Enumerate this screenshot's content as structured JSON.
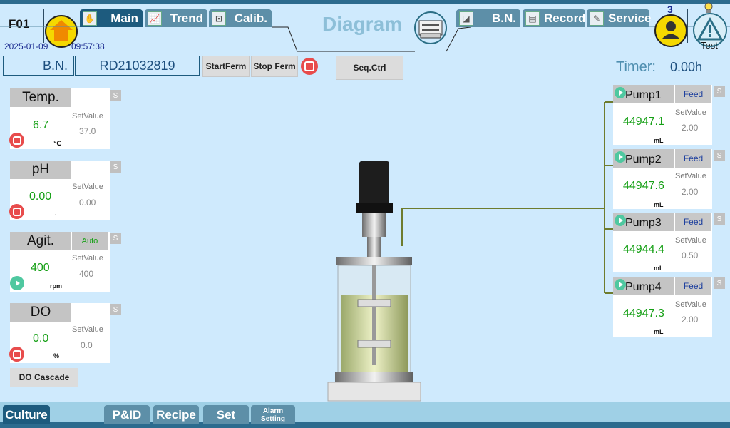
{
  "header": {
    "station": "F01",
    "date": "2025-01-09",
    "time": "09:57:38",
    "page_title": "Diagram",
    "tabs": [
      {
        "label": "Main",
        "icon": "hand-icon"
      },
      {
        "label": "Trend",
        "icon": "trend-icon"
      },
      {
        "label": "Calib.",
        "icon": "calib-icon"
      },
      {
        "label": "B.N.",
        "icon": "bn-icon"
      },
      {
        "label": "Record",
        "icon": "record-icon"
      },
      {
        "label": "Service",
        "icon": "service-icon"
      }
    ],
    "user_count": "3",
    "alarm_label": "Test"
  },
  "batch": {
    "label": "B.N.",
    "value": "RD21032819",
    "start_label": "StartFerm",
    "stop_label": "Stop Ferm",
    "seq_label": "Seq.Ctrl"
  },
  "timer": {
    "label": "Timer:",
    "value": "0.00h"
  },
  "params": [
    {
      "name": "Temp.",
      "value": "6.7",
      "setvalue_label": "SetValue",
      "setvalue": "37.0",
      "unit": "℃",
      "status": "stopped",
      "mode": "",
      "s": "S"
    },
    {
      "name": "pH",
      "value": "0.00",
      "setvalue_label": "SetValue",
      "setvalue": "0.00",
      "unit": ".",
      "status": "stopped",
      "mode": "",
      "s": "S"
    },
    {
      "name": "Agit.",
      "value": "400",
      "setvalue_label": "SetValue",
      "setvalue": "400",
      "unit": "rpm",
      "status": "running",
      "mode": "Auto",
      "s": "S"
    },
    {
      "name": "DO",
      "value": "0.0",
      "setvalue_label": "SetValue",
      "setvalue": "0.0",
      "unit": "%",
      "status": "stopped",
      "mode": "",
      "s": "S"
    }
  ],
  "do_cascade_label": "DO Cascade",
  "pumps": [
    {
      "name": "Pump1",
      "mode": "Feed",
      "value": "44947.1",
      "setvalue_label": "SetValue",
      "setvalue": "2.00",
      "unit": "mL",
      "s": "S"
    },
    {
      "name": "Pump2",
      "mode": "Feed",
      "value": "44947.6",
      "setvalue_label": "SetValue",
      "setvalue": "2.00",
      "unit": "mL",
      "s": "S"
    },
    {
      "name": "Pump3",
      "mode": "Feed",
      "value": "44944.4",
      "setvalue_label": "SetValue",
      "setvalue": "0.50",
      "unit": "mL",
      "s": "S"
    },
    {
      "name": "Pump4",
      "mode": "Feed",
      "value": "44947.3",
      "setvalue_label": "SetValue",
      "setvalue": "2.00",
      "unit": "mL",
      "s": "S"
    }
  ],
  "bottom_tabs": [
    {
      "label": "Culture"
    },
    {
      "label": "P&ID"
    },
    {
      "label": "Recipe"
    },
    {
      "label": "Set"
    },
    {
      "label_line1": "Alarm",
      "label_line2": "Setting"
    }
  ],
  "colors": {
    "accent": "#1d5b7e",
    "background": "#cfeafd",
    "value_green": "#16a016",
    "stop_red": "#e84c4c",
    "run_green": "#4fc8a0"
  }
}
